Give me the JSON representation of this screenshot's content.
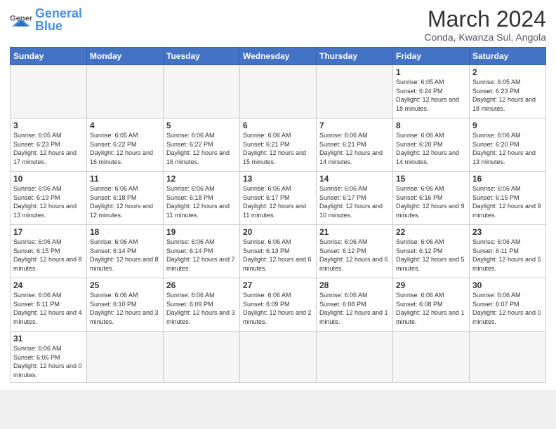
{
  "header": {
    "logo_general": "General",
    "logo_blue": "Blue",
    "month_title": "March 2024",
    "subtitle": "Conda, Kwanza Sul, Angola"
  },
  "weekdays": [
    "Sunday",
    "Monday",
    "Tuesday",
    "Wednesday",
    "Thursday",
    "Friday",
    "Saturday"
  ],
  "weeks": [
    [
      {
        "day": "",
        "info": ""
      },
      {
        "day": "",
        "info": ""
      },
      {
        "day": "",
        "info": ""
      },
      {
        "day": "",
        "info": ""
      },
      {
        "day": "",
        "info": ""
      },
      {
        "day": "1",
        "info": "Sunrise: 6:05 AM\nSunset: 6:24 PM\nDaylight: 12 hours\nand 18 minutes."
      },
      {
        "day": "2",
        "info": "Sunrise: 6:05 AM\nSunset: 6:23 PM\nDaylight: 12 hours\nand 18 minutes."
      }
    ],
    [
      {
        "day": "3",
        "info": "Sunrise: 6:05 AM\nSunset: 6:23 PM\nDaylight: 12 hours\nand 17 minutes."
      },
      {
        "day": "4",
        "info": "Sunrise: 6:05 AM\nSunset: 6:22 PM\nDaylight: 12 hours\nand 16 minutes."
      },
      {
        "day": "5",
        "info": "Sunrise: 6:06 AM\nSunset: 6:22 PM\nDaylight: 12 hours\nand 16 minutes."
      },
      {
        "day": "6",
        "info": "Sunrise: 6:06 AM\nSunset: 6:21 PM\nDaylight: 12 hours\nand 15 minutes."
      },
      {
        "day": "7",
        "info": "Sunrise: 6:06 AM\nSunset: 6:21 PM\nDaylight: 12 hours\nand 14 minutes."
      },
      {
        "day": "8",
        "info": "Sunrise: 6:06 AM\nSunset: 6:20 PM\nDaylight: 12 hours\nand 14 minutes."
      },
      {
        "day": "9",
        "info": "Sunrise: 6:06 AM\nSunset: 6:20 PM\nDaylight: 12 hours\nand 13 minutes."
      }
    ],
    [
      {
        "day": "10",
        "info": "Sunrise: 6:06 AM\nSunset: 6:19 PM\nDaylight: 12 hours\nand 13 minutes."
      },
      {
        "day": "11",
        "info": "Sunrise: 6:06 AM\nSunset: 6:18 PM\nDaylight: 12 hours\nand 12 minutes."
      },
      {
        "day": "12",
        "info": "Sunrise: 6:06 AM\nSunset: 6:18 PM\nDaylight: 12 hours\nand 11 minutes."
      },
      {
        "day": "13",
        "info": "Sunrise: 6:06 AM\nSunset: 6:17 PM\nDaylight: 12 hours\nand 11 minutes."
      },
      {
        "day": "14",
        "info": "Sunrise: 6:06 AM\nSunset: 6:17 PM\nDaylight: 12 hours\nand 10 minutes."
      },
      {
        "day": "15",
        "info": "Sunrise: 6:06 AM\nSunset: 6:16 PM\nDaylight: 12 hours\nand 9 minutes."
      },
      {
        "day": "16",
        "info": "Sunrise: 6:06 AM\nSunset: 6:15 PM\nDaylight: 12 hours\nand 9 minutes."
      }
    ],
    [
      {
        "day": "17",
        "info": "Sunrise: 6:06 AM\nSunset: 6:15 PM\nDaylight: 12 hours\nand 8 minutes."
      },
      {
        "day": "18",
        "info": "Sunrise: 6:06 AM\nSunset: 6:14 PM\nDaylight: 12 hours\nand 8 minutes."
      },
      {
        "day": "19",
        "info": "Sunrise: 6:06 AM\nSunset: 6:14 PM\nDaylight: 12 hours\nand 7 minutes."
      },
      {
        "day": "20",
        "info": "Sunrise: 6:06 AM\nSunset: 6:13 PM\nDaylight: 12 hours\nand 6 minutes."
      },
      {
        "day": "21",
        "info": "Sunrise: 6:06 AM\nSunset: 6:12 PM\nDaylight: 12 hours\nand 6 minutes."
      },
      {
        "day": "22",
        "info": "Sunrise: 6:06 AM\nSunset: 6:12 PM\nDaylight: 12 hours\nand 5 minutes."
      },
      {
        "day": "23",
        "info": "Sunrise: 6:06 AM\nSunset: 6:11 PM\nDaylight: 12 hours\nand 5 minutes."
      }
    ],
    [
      {
        "day": "24",
        "info": "Sunrise: 6:06 AM\nSunset: 6:11 PM\nDaylight: 12 hours\nand 4 minutes."
      },
      {
        "day": "25",
        "info": "Sunrise: 6:06 AM\nSunset: 6:10 PM\nDaylight: 12 hours\nand 3 minutes."
      },
      {
        "day": "26",
        "info": "Sunrise: 6:06 AM\nSunset: 6:09 PM\nDaylight: 12 hours\nand 3 minutes."
      },
      {
        "day": "27",
        "info": "Sunrise: 6:06 AM\nSunset: 6:09 PM\nDaylight: 12 hours\nand 2 minutes."
      },
      {
        "day": "28",
        "info": "Sunrise: 6:06 AM\nSunset: 6:08 PM\nDaylight: 12 hours\nand 1 minute."
      },
      {
        "day": "29",
        "info": "Sunrise: 6:06 AM\nSunset: 6:08 PM\nDaylight: 12 hours\nand 1 minute."
      },
      {
        "day": "30",
        "info": "Sunrise: 6:06 AM\nSunset: 6:07 PM\nDaylight: 12 hours\nand 0 minutes."
      }
    ],
    [
      {
        "day": "31",
        "info": "Sunrise: 6:06 AM\nSunset: 6:06 PM\nDaylight: 12 hours\nand 0 minutes."
      },
      {
        "day": "",
        "info": ""
      },
      {
        "day": "",
        "info": ""
      },
      {
        "day": "",
        "info": ""
      },
      {
        "day": "",
        "info": ""
      },
      {
        "day": "",
        "info": ""
      },
      {
        "day": "",
        "info": ""
      }
    ]
  ]
}
